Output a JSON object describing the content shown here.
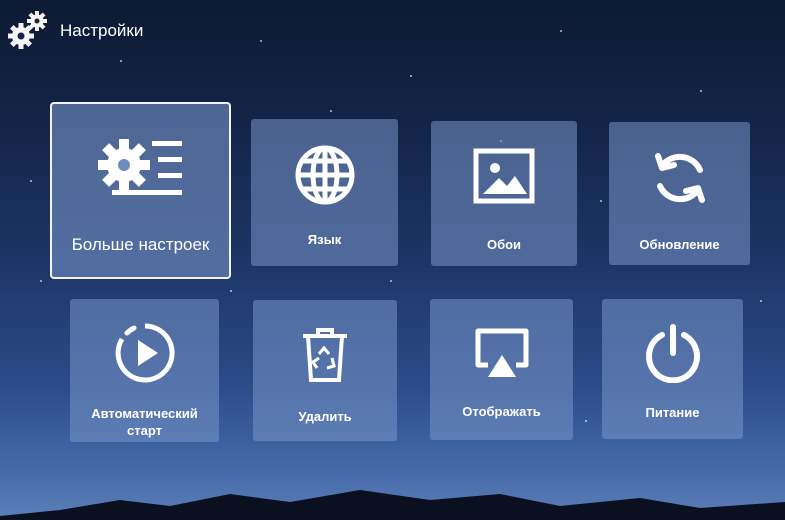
{
  "header": {
    "title": "Настройки",
    "icon": "gears-icon"
  },
  "tiles": [
    {
      "id": "more-settings",
      "label": "Больше настроек",
      "icon": "gear-list-icon",
      "focused": true
    },
    {
      "id": "language",
      "label": "Язык",
      "icon": "globe-icon"
    },
    {
      "id": "wallpaper",
      "label": "Обои",
      "icon": "image-icon"
    },
    {
      "id": "update",
      "label": "Обновление",
      "icon": "refresh-icon"
    },
    {
      "id": "autostart",
      "label": "Автоматический старт",
      "icon": "play-circle-icon"
    },
    {
      "id": "delete",
      "label": "Удалить",
      "icon": "trash-recycle-icon"
    },
    {
      "id": "display",
      "label": "Отображать",
      "icon": "airplay-icon"
    },
    {
      "id": "power",
      "label": "Питание",
      "icon": "power-icon"
    }
  ],
  "colors": {
    "tile_bg": "#7896c8",
    "focus_border": "#f2f4f8",
    "text": "#ffffff"
  }
}
